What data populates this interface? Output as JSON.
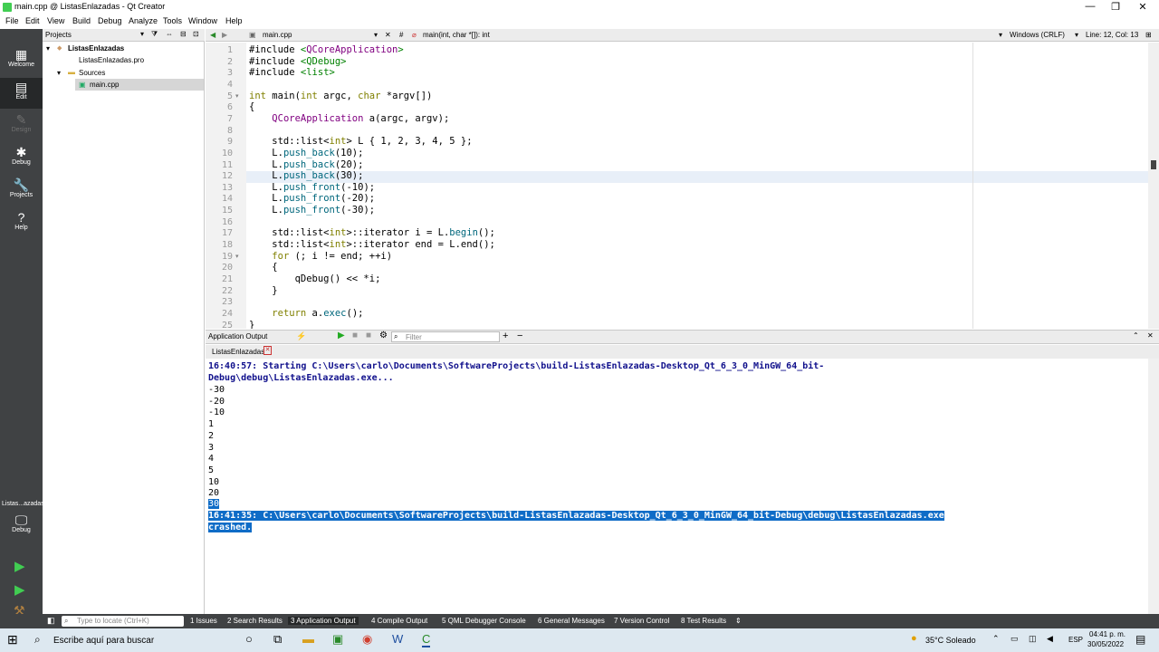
{
  "window": {
    "title": "main.cpp @ ListasEnlazadas - Qt Creator"
  },
  "menu": [
    "File",
    "Edit",
    "View",
    "Build",
    "Debug",
    "Analyze",
    "Tools",
    "Window",
    "Help"
  ],
  "modes": [
    {
      "label": "Welcome",
      "icon": "▦"
    },
    {
      "label": "Edit",
      "icon": "▤"
    },
    {
      "label": "Design",
      "icon": "✎"
    },
    {
      "label": "Debug",
      "icon": "✱"
    },
    {
      "label": "Projects",
      "icon": "🔧"
    },
    {
      "label": "Help",
      "icon": "?"
    }
  ],
  "kit": {
    "project": "Listas...azadas",
    "mode": "Debug"
  },
  "projects": {
    "header": "Projects",
    "root": "ListasEnlazadas",
    "pro_file": "ListasEnlazadas.pro",
    "sources": "Sources",
    "main": "main.cpp"
  },
  "editor": {
    "file_tab": "main.cpp",
    "hash": "#",
    "function": "main(int, char *[]): int",
    "line_ending": "Windows (CRLF)",
    "position": "Line: 12, Col: 13",
    "line_numbers": [
      "1",
      "2",
      "3",
      "4",
      "5",
      "6",
      "7",
      "8",
      "9",
      "10",
      "11",
      "12",
      "13",
      "14",
      "15",
      "16",
      "17",
      "18",
      "19",
      "20",
      "21",
      "22",
      "23",
      "24",
      "25"
    ],
    "lines": [
      "#include <QCoreApplication>",
      "#include <QDebug>",
      "#include <list>",
      "",
      "int main(int argc, char *argv[])",
      "{",
      "    QCoreApplication a(argc, argv);",
      "",
      "    std::list<int> L { 1, 2, 3, 4, 5 };",
      "    L.push_back(10);",
      "    L.push_back(20);",
      "    L.push_back(30);",
      "    L.push_front(-10);",
      "    L.push_front(-20);",
      "    L.push_front(-30);",
      "",
      "    std::list<int>::iterator i = L.begin();",
      "    std::list<int>::iterator end = L.end();",
      "    for (; i != end; ++i)",
      "    {",
      "        qDebug() << *i;",
      "    }",
      "",
      "    return a.exec();",
      "}"
    ]
  },
  "output": {
    "pane_title": "Application Output",
    "filter_placeholder": "Filter",
    "tab": "ListasEnlazadas",
    "start_line1": "16:40:57: Starting C:\\Users\\carlo\\Documents\\SoftwareProjects\\build-ListasEnlazadas-Desktop_Qt_6_3_0_MinGW_64_bit-",
    "start_line2": "Debug\\debug\\ListasEnlazadas.exe...",
    "values": [
      "-30",
      "-20",
      "-10",
      "1",
      "2",
      "3",
      "4",
      "5",
      "10",
      "20"
    ],
    "last_value": "30",
    "crash_line1": "16:41:35: C:\\Users\\carlo\\Documents\\SoftwareProjects\\build-ListasEnlazadas-Desktop_Qt_6_3_0_MinGW_64_bit-Debug\\debug\\ListasEnlazadas.exe",
    "crash_line2": "crashed."
  },
  "statusbar": {
    "locator_placeholder": "Type to locate (Ctrl+K)",
    "panes": [
      "1  Issues",
      "2  Search Results",
      "3  Application Output",
      "4  Compile Output",
      "5  QML Debugger Console",
      "6  General Messages",
      "7  Version Control",
      "8  Test Results"
    ]
  },
  "taskbar": {
    "search_placeholder": "Escribe aquí para buscar",
    "weather": "35°C  Soleado",
    "language": "ESP",
    "time": "04:41 p. m.",
    "date": "30/05/2022"
  }
}
